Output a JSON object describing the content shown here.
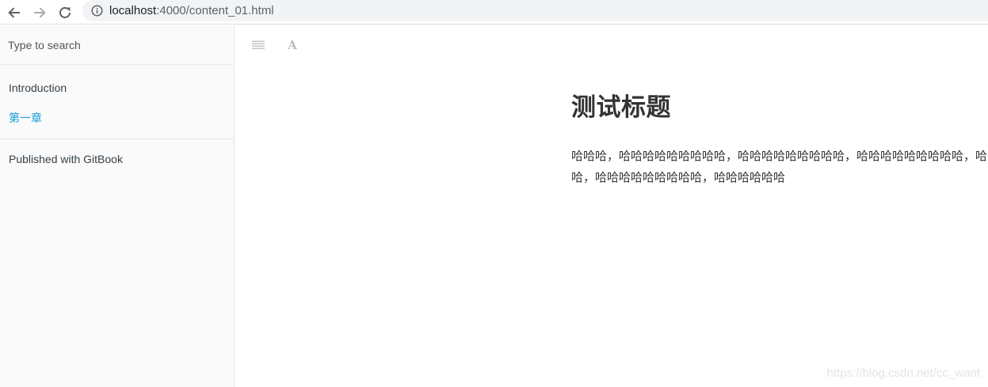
{
  "browser": {
    "url_host": "localhost",
    "url_path": ":4000/content_01.html",
    "icons": {
      "back": "arrow-left-icon",
      "forward": "arrow-right-icon",
      "reload": "reload-icon",
      "info": "info-circle-icon"
    }
  },
  "sidebar": {
    "search_placeholder": "Type to search",
    "items": [
      {
        "label": "Introduction",
        "active": false
      },
      {
        "label": "第一章",
        "active": true
      }
    ],
    "published": "Published with GitBook",
    "colors": {
      "active": "#1a9dd9",
      "text": "#364149"
    }
  },
  "toolbar": {
    "toc_icon": "menu-lines-icon",
    "font_label": "A",
    "font_icon": "font-settings-icon"
  },
  "page": {
    "title": "测试标题",
    "paragraph": "哈哈哈，哈哈哈哈哈哈哈哈哈，哈哈哈哈哈哈哈哈哈，哈哈哈哈哈哈哈哈哈，哈哈哈哈哈哈哈，哈哈哈哈哈哈哈哈哈，哈哈哈哈哈哈"
  },
  "watermark": "https://blog.csdn.net/cc_want"
}
